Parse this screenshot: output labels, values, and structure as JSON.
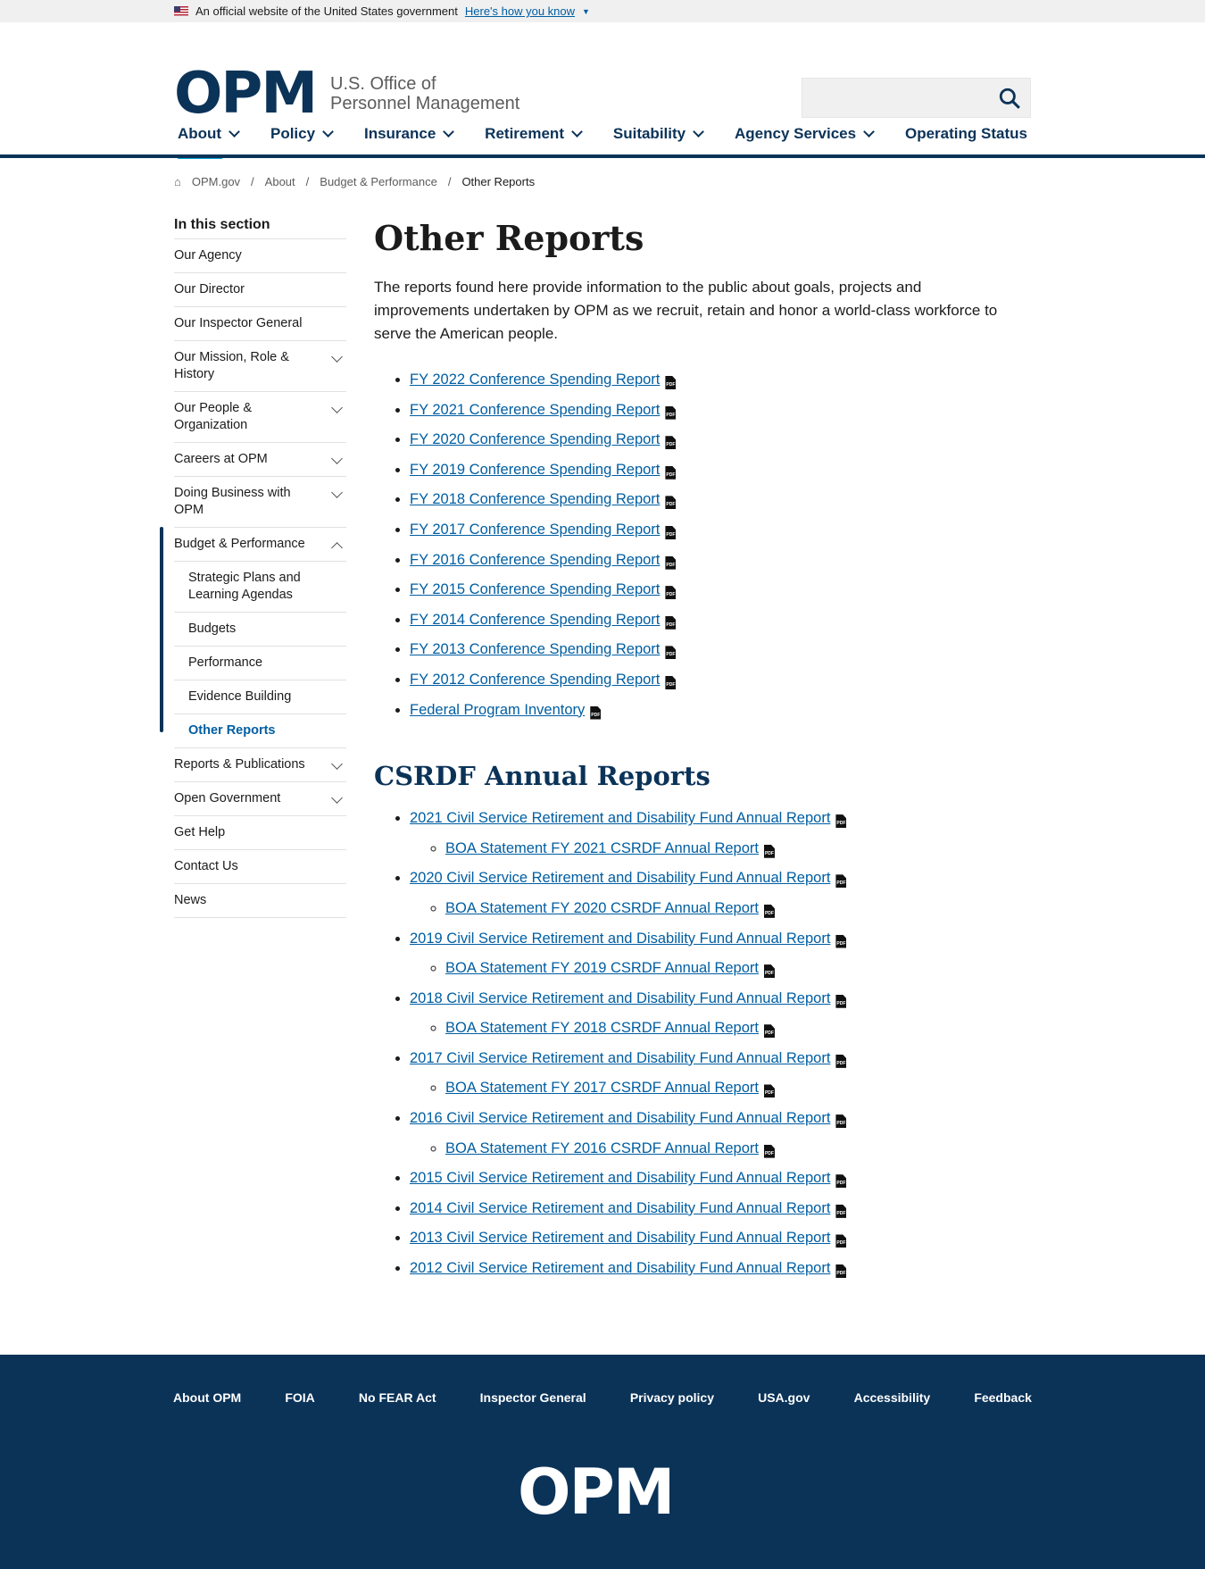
{
  "banner": {
    "text": "An official website of the United States government",
    "link": "Here's how you know"
  },
  "header": {
    "logo": "OPM",
    "org_line1": "U.S. Office of",
    "org_line2": "Personnel Management"
  },
  "nav": [
    "About",
    "Policy",
    "Insurance",
    "Retirement",
    "Suitability",
    "Agency Services",
    "Operating Status"
  ],
  "breadcrumb": [
    "OPM.gov",
    "About",
    "Budget & Performance",
    "Other Reports"
  ],
  "sidebar": {
    "title": "In this section",
    "items": [
      {
        "label": "Our Agency"
      },
      {
        "label": "Our Director"
      },
      {
        "label": "Our Inspector General"
      },
      {
        "label": "Our Mission, Role & History",
        "expand": "down"
      },
      {
        "label": "Our People & Organization",
        "expand": "down"
      },
      {
        "label": "Careers at OPM",
        "expand": "down"
      },
      {
        "label": "Doing Business with OPM",
        "expand": "down"
      },
      {
        "label": "Budget & Performance",
        "expand": "up"
      },
      {
        "label": "Strategic Plans and Learning Agendas",
        "sub": true
      },
      {
        "label": "Budgets",
        "sub": true
      },
      {
        "label": "Performance",
        "sub": true
      },
      {
        "label": "Evidence Building",
        "sub": true
      },
      {
        "label": "Other Reports",
        "sub": true,
        "current": true
      },
      {
        "label": "Reports & Publications",
        "expand": "down"
      },
      {
        "label": "Open Government",
        "expand": "down"
      },
      {
        "label": "Get Help"
      },
      {
        "label": "Contact Us"
      },
      {
        "label": "News"
      }
    ]
  },
  "main": {
    "title": "Other Reports",
    "intro": "The reports found here provide information to the public about goals, projects and improvements undertaken by OPM as we recruit, retain and honor a world-class workforce to serve the American people.",
    "reports": [
      "FY 2022 Conference Spending Report",
      "FY 2021 Conference Spending Report",
      "FY 2020 Conference Spending Report",
      "FY 2019 Conference Spending Report",
      "FY 2018 Conference Spending Report",
      "FY 2017 Conference Spending Report",
      "FY 2016 Conference Spending Report",
      "FY 2015 Conference Spending Report",
      "FY 2014 Conference Spending Report",
      "FY 2013 Conference Spending Report",
      "FY 2012 Conference Spending Report",
      "Federal Program Inventory"
    ],
    "csrdf_title": "CSRDF Annual Reports",
    "csrdf": [
      {
        "label": "2021 Civil Service Retirement and Disability Fund Annual Report",
        "sub": "BOA Statement FY 2021 CSRDF Annual Report"
      },
      {
        "label": "2020 Civil Service Retirement and Disability Fund Annual Report",
        "sub": "BOA Statement FY 2020 CSRDF Annual Report"
      },
      {
        "label": "2019 Civil Service Retirement and Disability Fund Annual Report",
        "sub": "BOA Statement FY 2019 CSRDF Annual Report"
      },
      {
        "label": "2018 Civil Service Retirement and Disability Fund Annual Report",
        "sub": "BOA Statement FY 2018 CSRDF Annual Report"
      },
      {
        "label": "2017 Civil Service Retirement and Disability Fund Annual Report",
        "sub": "BOA Statement FY 2017 CSRDF Annual Report"
      },
      {
        "label": "2016 Civil Service Retirement and Disability Fund Annual Report",
        "sub": "BOA Statement FY 2016 CSRDF Annual Report"
      },
      {
        "label": "2015 Civil Service Retirement and Disability Fund Annual Report"
      },
      {
        "label": "2014 Civil Service Retirement and Disability Fund Annual Report"
      },
      {
        "label": "2013 Civil Service Retirement and Disability Fund Annual Report"
      },
      {
        "label": "2012 Civil Service Retirement and Disability Fund Annual Report"
      }
    ],
    "pdf_badge": "PDF"
  },
  "footer": {
    "links": [
      "About OPM",
      "FOIA",
      "No FEAR Act",
      "Inspector General",
      "Privacy policy",
      "USA.gov",
      "Accessibility",
      "Feedback"
    ],
    "logo": "OPM"
  },
  "colors": {
    "brand": "#0b3358",
    "link": "#005ea2",
    "accent": "#00a6d2"
  }
}
